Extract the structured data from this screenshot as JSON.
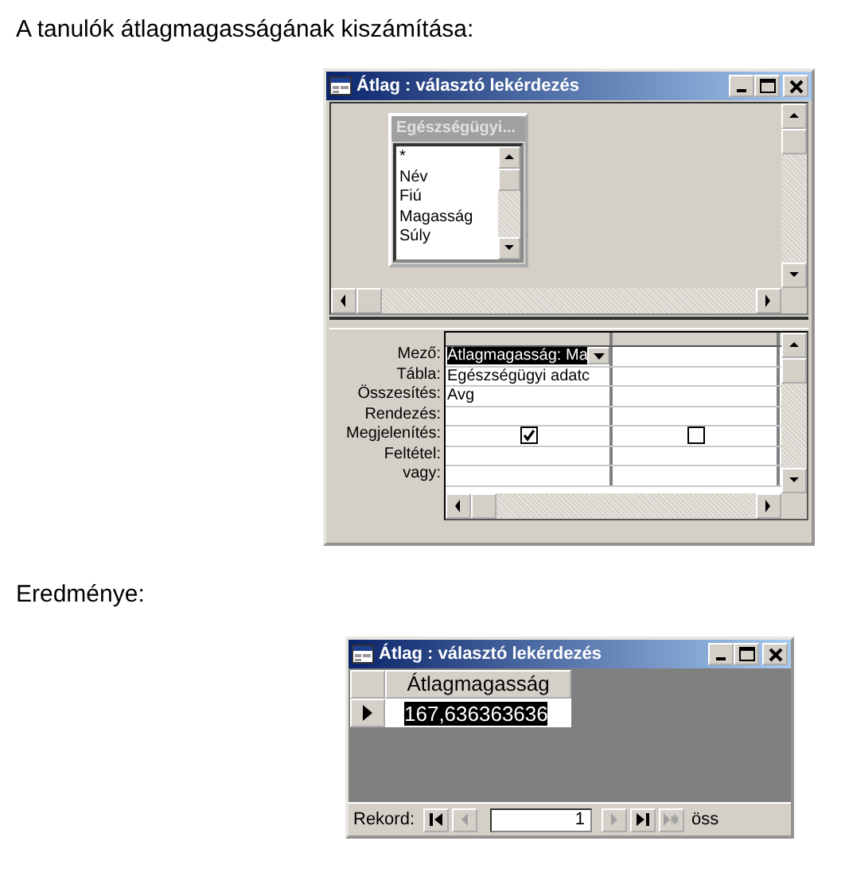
{
  "heading": "A tanulók átlagmagasságának kiszámítása:",
  "design_window": {
    "title": "Átlag : választó lekérdezés",
    "table": {
      "title": "Egészségügyi...",
      "fields": [
        "*",
        "Név",
        "Fiú",
        "Magasság",
        "Súly"
      ]
    },
    "grid": {
      "rows": [
        {
          "label": "Mező:",
          "cells": [
            {
              "kind": "dropdown",
              "value": "Átlagmagasság: Ma",
              "selected": true
            },
            {
              "kind": "empty"
            }
          ]
        },
        {
          "label": "Tábla:",
          "cells": [
            {
              "kind": "text",
              "value": "Egészségügyi adatc"
            },
            {
              "kind": "empty"
            }
          ]
        },
        {
          "label": "Összesítés:",
          "cells": [
            {
              "kind": "text",
              "value": "Avg"
            },
            {
              "kind": "empty"
            }
          ]
        },
        {
          "label": "Rendezés:",
          "cells": [
            {
              "kind": "empty"
            },
            {
              "kind": "empty"
            }
          ]
        },
        {
          "label": "Megjelenítés:",
          "cells": [
            {
              "kind": "checkbox",
              "checked": true
            },
            {
              "kind": "checkbox",
              "checked": false
            }
          ]
        },
        {
          "label": "Feltétel:",
          "cells": [
            {
              "kind": "empty"
            },
            {
              "kind": "empty"
            }
          ]
        },
        {
          "label": "vagy:",
          "cells": [
            {
              "kind": "empty"
            },
            {
              "kind": "empty"
            }
          ]
        }
      ]
    }
  },
  "result_caption": "Eredménye:",
  "result_window": {
    "title": "Átlag : választó lekérdezés",
    "column": "Átlagmagasság",
    "rows": [
      {
        "value": "167,636363636",
        "selected": true
      }
    ],
    "navigation": {
      "label": "Rekord:",
      "record": "1",
      "trailing": "öss",
      "buttons": [
        {
          "kind": "first",
          "disabled": false
        },
        {
          "kind": "prev",
          "disabled": true
        },
        {
          "kind": "next",
          "disabled": true
        },
        {
          "kind": "last",
          "disabled": false
        },
        {
          "kind": "new",
          "disabled": true
        }
      ]
    }
  }
}
